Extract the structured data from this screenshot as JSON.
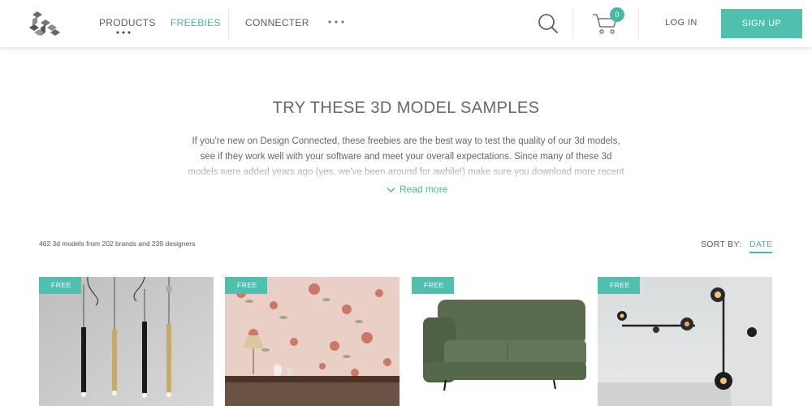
{
  "header": {
    "logo": "design-connected-logo",
    "nav": {
      "products": "PRODUCTS",
      "freebies": "FREEBIES",
      "connecter": "CONNECTER",
      "more": "more-dots-icon"
    },
    "cart_count": "0",
    "login": "LOG IN",
    "signup": "SIGN UP",
    "accent_color": "#45b9a6"
  },
  "intro": {
    "title": "TRY THESE 3D MODEL SAMPLES",
    "text": "If you're new on Design Connected, these freebies are the best way to test the quality of our 3d models, see if they work well with your software and meet your overall expectations. Since many of these 3d models were added years ago (yes, we've been around for awhile!) make sure you download more recent ones to become",
    "read_more": "Read more"
  },
  "results": {
    "count_text": "462 3d models from 202 brands and 239 designers",
    "sort_label": "SORT BY:",
    "sort_value": "DATE"
  },
  "products": [
    {
      "badge": "FREE",
      "image": "pendant-lamps"
    },
    {
      "badge": "FREE",
      "image": "floral-wallpaper-table-lamp"
    },
    {
      "badge": "FREE",
      "image": "green-sofa"
    },
    {
      "badge": "FREE",
      "image": "wall-lamps"
    }
  ]
}
